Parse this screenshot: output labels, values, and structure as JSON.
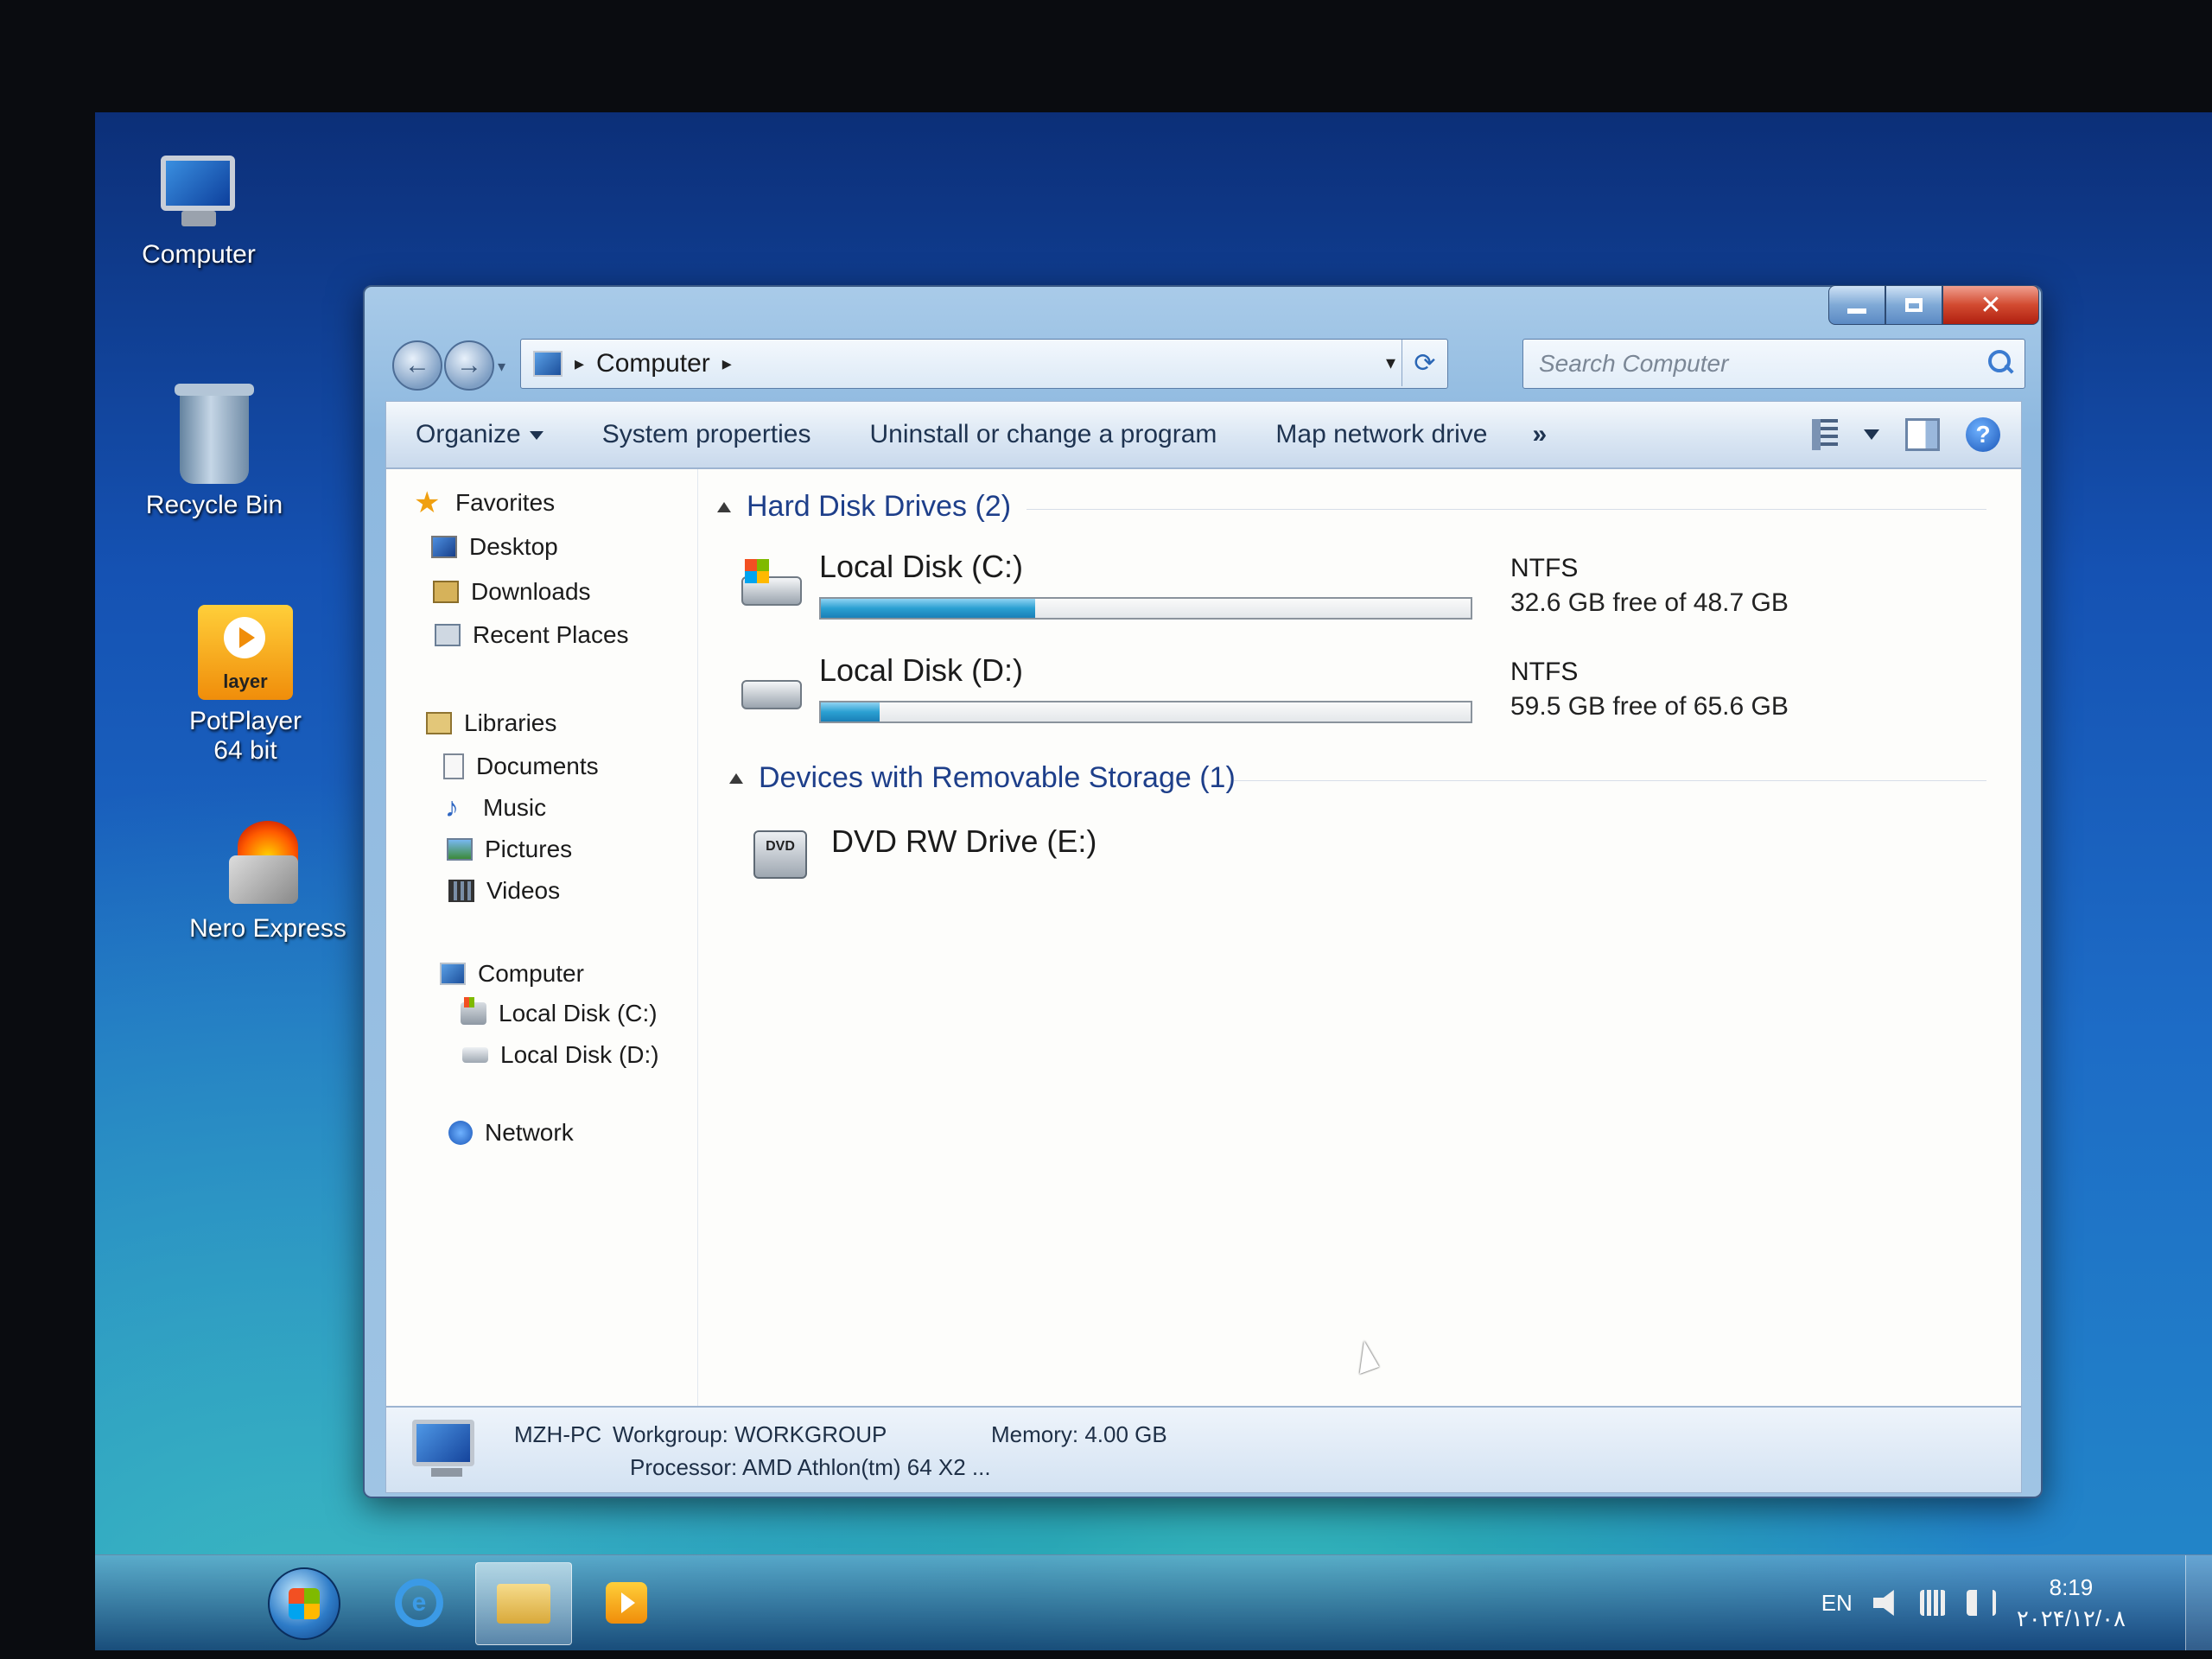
{
  "desktop": {
    "icons": [
      {
        "label": "Computer"
      },
      {
        "label": "Recycle Bin"
      },
      {
        "label": "PotPlayer 64 bit",
        "badge": "layer"
      },
      {
        "label": "Nero Express"
      }
    ]
  },
  "window": {
    "address": {
      "location": "Computer"
    },
    "search": {
      "placeholder": "Search Computer"
    },
    "commands": {
      "organize": "Organize",
      "system_properties": "System properties",
      "uninstall": "Uninstall or change a program",
      "map_drive": "Map network drive",
      "more": "»"
    },
    "help_glyph": "?",
    "nav": {
      "favorites": "Favorites",
      "desktop": "Desktop",
      "downloads": "Downloads",
      "recent": "Recent Places",
      "libraries": "Libraries",
      "documents": "Documents",
      "music": "Music",
      "pictures": "Pictures",
      "videos": "Videos",
      "computer": "Computer",
      "disk_c": "Local Disk (C:)",
      "disk_d": "Local Disk (D:)",
      "network": "Network"
    },
    "groups": {
      "hdd": "Hard Disk Drives (2)",
      "removable": "Devices with Removable Storage (1)"
    },
    "drives": [
      {
        "name": "Local Disk (C:)",
        "fs": "NTFS",
        "free": "32.6 GB free of 48.7 GB",
        "used_fraction": 0.33
      },
      {
        "name": "Local Disk (D:)",
        "fs": "NTFS",
        "free": "59.5 GB free of 65.6 GB",
        "used_fraction": 0.09
      }
    ],
    "dvd": {
      "name": "DVD RW Drive (E:)",
      "badge": "DVD"
    },
    "details": {
      "pc_name": "MZH-PC",
      "workgroup": "Workgroup: WORKGROUP",
      "memory": "Memory: 4.00 GB",
      "processor": "Processor: AMD Athlon(tm) 64 X2 ..."
    }
  },
  "taskbar": {
    "lang": "EN",
    "time": "8:19",
    "date": "۲۰۲۴/۱۲/۰۸",
    "ie_glyph": "e"
  },
  "icons": [
    "computer-icon",
    "recycle-bin-icon",
    "potplayer-icon",
    "nero-icon",
    "back-icon",
    "forward-icon",
    "refresh-icon",
    "search-icon",
    "views-icon",
    "preview-pane-icon",
    "help-icon",
    "star-icon",
    "hdd-icon",
    "dvd-icon",
    "start-orb",
    "ie-icon",
    "folder-icon",
    "volume-icon",
    "network-icon"
  ]
}
